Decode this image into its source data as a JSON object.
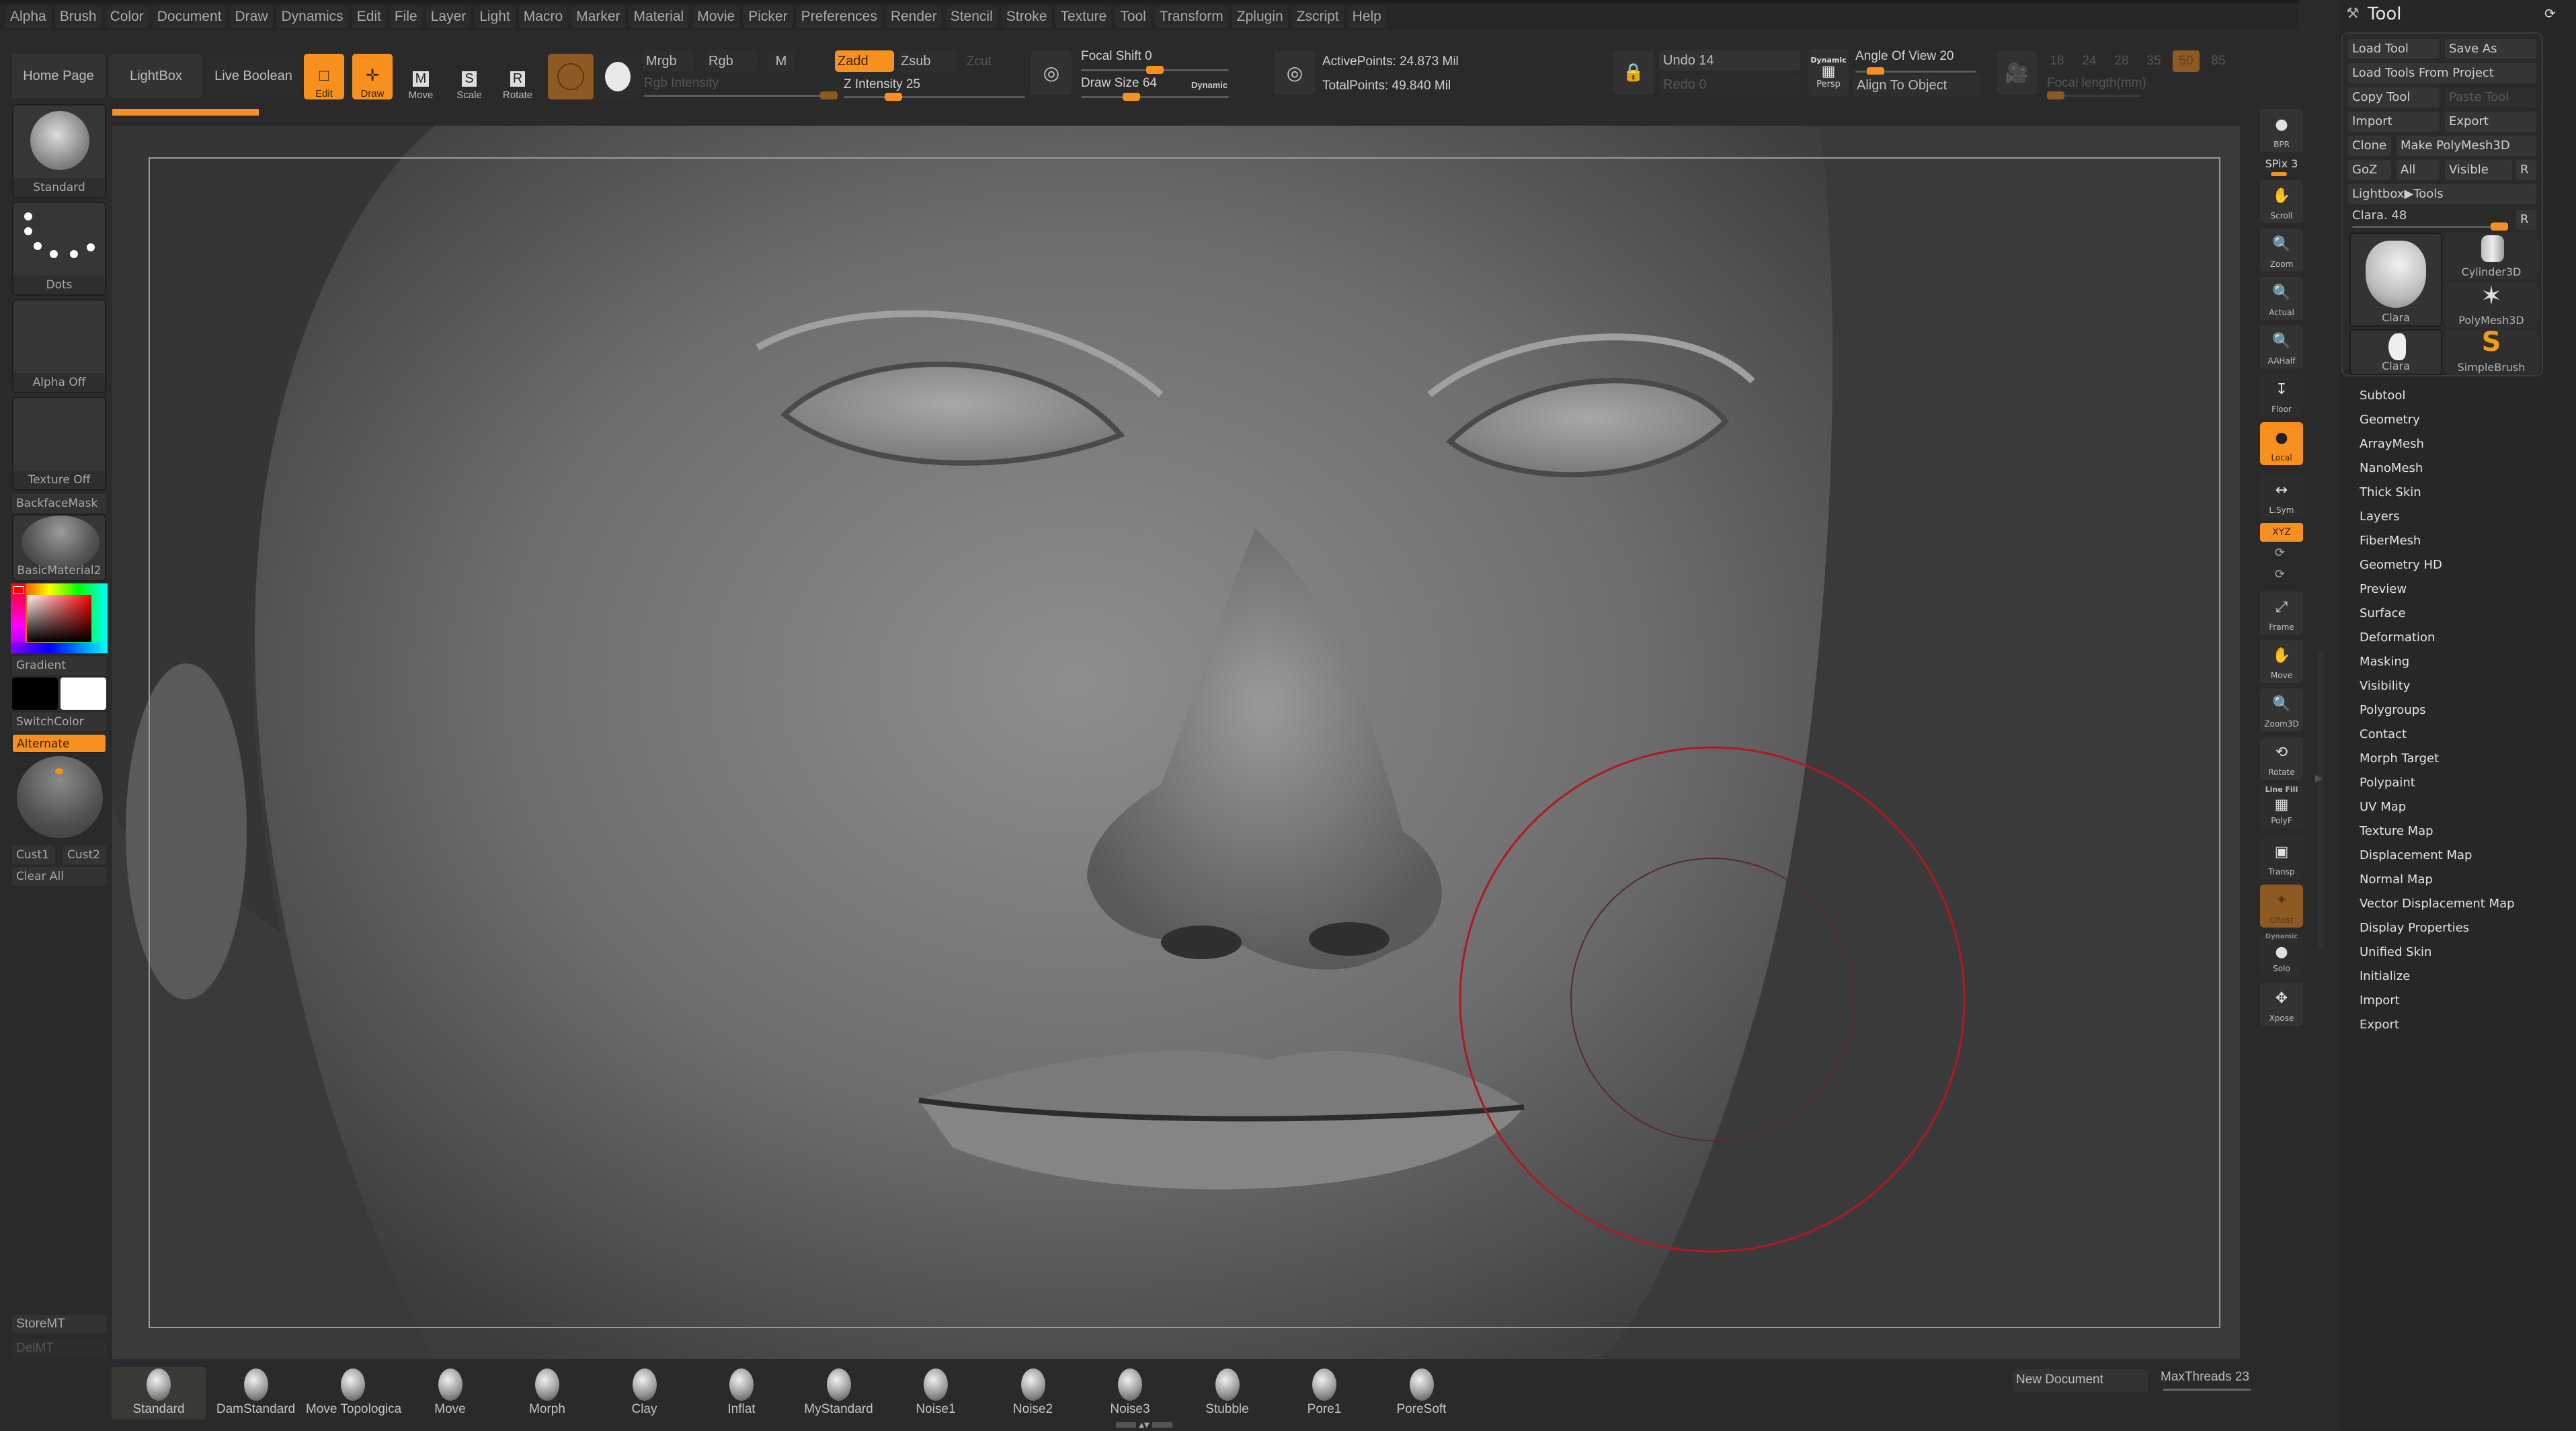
{
  "menubar": {
    "items": [
      "Alpha",
      "Brush",
      "Color",
      "Document",
      "Draw",
      "Dynamics",
      "Edit",
      "File",
      "Layer",
      "Light",
      "Macro",
      "Marker",
      "Material",
      "Movie",
      "Picker",
      "Preferences",
      "Render",
      "Stencil",
      "Stroke",
      "Texture",
      "Tool",
      "Transform",
      "Zplugin",
      "Zscript",
      "Help"
    ]
  },
  "toolbar": {
    "home_page": "Home Page",
    "lightbox": "LightBox",
    "live_boolean": "Live Boolean",
    "edit": "Edit",
    "draw": "Draw",
    "move": "Move",
    "scale": "Scale",
    "rotate": "Rotate",
    "mrgb": "Mrgb",
    "rgb": "Rgb",
    "m": "M",
    "rgb_intensity": "Rgb Intensity",
    "zadd": "Zadd",
    "zsub": "Zsub",
    "zcut": "Zcut",
    "z_intensity": "Z Intensity 25",
    "z_intensity_value": 25,
    "focal_shift": "Focal Shift 0",
    "focal_shift_value": 0,
    "draw_size": "Draw Size 64",
    "draw_size_value": 64,
    "dynamic": "Dynamic",
    "active_points": "ActivePoints: 24.873 Mil",
    "total_points": "TotalPoints: 49.840 Mil",
    "undo": "Undo 14",
    "redo": "Redo 0",
    "persp_dynamic": "Dynamic",
    "persp": "Persp",
    "angle_of_view": "Angle Of View 20",
    "angle_of_view_value": 20,
    "align_to_object": "Align To Object",
    "focal_lengths": [
      "18",
      "24",
      "28",
      "35",
      "50",
      "85"
    ],
    "focal_length_selected": "50",
    "focal_length_label": "Focal length(mm)"
  },
  "leftshelf": {
    "brush": "Standard",
    "stroke": "Dots",
    "alpha": "Alpha Off",
    "texture": "Texture Off",
    "backface_mask": "BackfaceMask",
    "material": "BasicMaterial2",
    "gradient": "Gradient",
    "switch_color": "SwitchColor",
    "alternate": "Alternate",
    "cust1": "Cust1",
    "cust2": "Cust2",
    "clear_all": "Clear All",
    "store_mt": "StoreMT",
    "del_mt": "DelMT",
    "main_color": "#ff0000",
    "secondary_color_black": "#000000",
    "secondary_color_white": "#ffffff"
  },
  "rightshelf": {
    "bpr": "BPR",
    "spix": "SPix 3",
    "buttons": [
      "Scroll",
      "Zoom",
      "Actual",
      "AAHalf",
      "Floor",
      "Local",
      "L.Sym",
      "XYZ",
      "Frame",
      "Move",
      "Zoom3D",
      "Rotate",
      "PolyF",
      "Transp",
      "Ghost",
      "Solo",
      "Xpose"
    ],
    "line_fill": "Line Fill",
    "solo_dynamic": "Dynamic"
  },
  "toolpalette": {
    "title": "Tool",
    "load_tool": "Load Tool",
    "save_as": "Save As",
    "load_tools_from_project": "Load Tools From Project",
    "copy_tool": "Copy Tool",
    "paste_tool": "Paste Tool",
    "import": "Import",
    "export": "Export",
    "clone": "Clone",
    "make_polymesh3d": "Make PolyMesh3D",
    "goz": "GoZ",
    "all": "All",
    "visible": "Visible",
    "r": "R",
    "lightbox_tools": "Lightbox▶Tools",
    "current_tool_slider": "Clara. 48",
    "current_tool_value": 48,
    "thumbs": [
      "Clara",
      "Cylinder3D",
      "PolyMesh3D",
      "Clara",
      "SimpleBrush"
    ],
    "menu": [
      "Subtool",
      "Geometry",
      "ArrayMesh",
      "NanoMesh",
      "Thick Skin",
      "Layers",
      "FiberMesh",
      "Geometry HD",
      "Preview",
      "Surface",
      "Deformation",
      "Masking",
      "Visibility",
      "Polygroups",
      "Contact",
      "Morph Target",
      "Polypaint",
      "UV Map",
      "Texture Map",
      "Displacement Map",
      "Normal Map",
      "Vector Displacement Map",
      "Display Properties",
      "Unified Skin",
      "Initialize",
      "Import",
      "Export"
    ]
  },
  "tray": {
    "brushes": [
      "Standard",
      "DamStandard",
      "Move Topologica",
      "Move",
      "Morph",
      "Clay",
      "Inflat",
      "MyStandard",
      "Noise1",
      "Noise2",
      "Noise3",
      "Stubble",
      "Pore1",
      "PoreSoft"
    ],
    "new_document": "New Document",
    "max_threads": "MaxThreads 23"
  },
  "colors": {
    "accent": "#f7901e",
    "accent_dim": "#8c5a22",
    "brush_cursor": "#b0191e"
  }
}
